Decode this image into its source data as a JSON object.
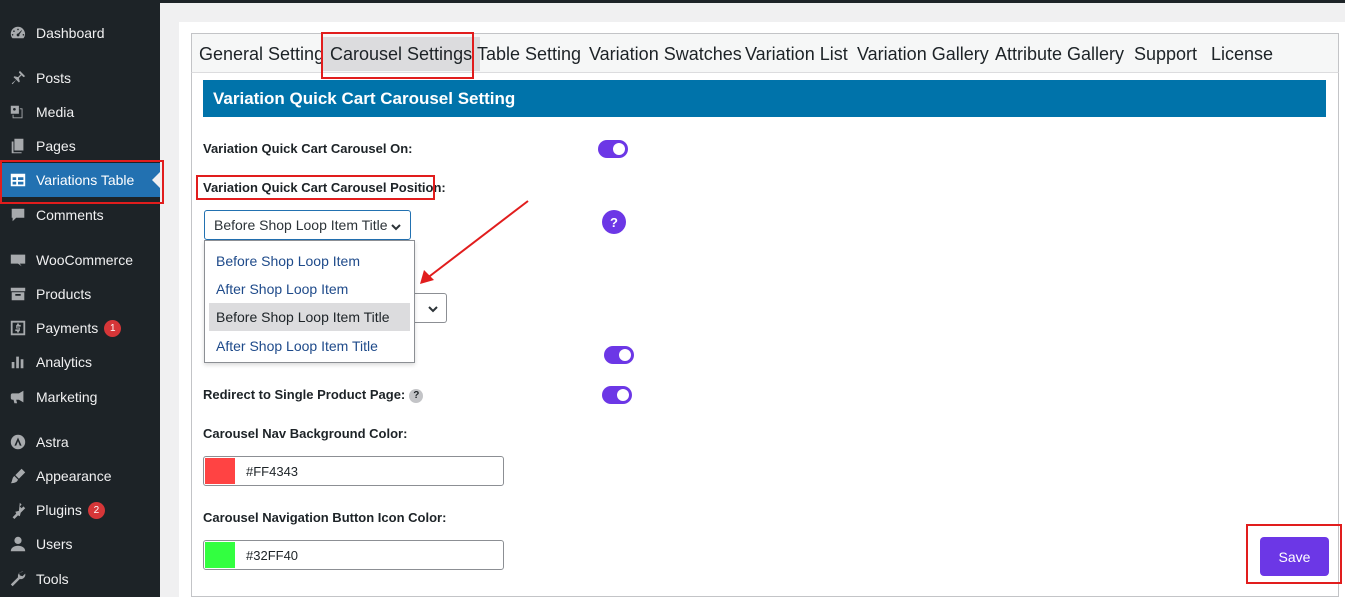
{
  "sidebar": {
    "items": [
      {
        "label": "Dashboard",
        "icon": "dashboard-icon",
        "badge": ""
      },
      {
        "label": "Posts",
        "icon": "pin-icon",
        "badge": ""
      },
      {
        "label": "Media",
        "icon": "media-icon",
        "badge": ""
      },
      {
        "label": "Pages",
        "icon": "pages-icon",
        "badge": ""
      },
      {
        "label": "Variations Table",
        "icon": "table-icon",
        "badge": ""
      },
      {
        "label": "Comments",
        "icon": "comment-icon",
        "badge": ""
      },
      {
        "label": "WooCommerce",
        "icon": "woo-icon",
        "badge": ""
      },
      {
        "label": "Products",
        "icon": "archive-icon",
        "badge": ""
      },
      {
        "label": "Payments",
        "icon": "dollar-icon",
        "badge": "1"
      },
      {
        "label": "Analytics",
        "icon": "chart-icon",
        "badge": ""
      },
      {
        "label": "Marketing",
        "icon": "megaphone-icon",
        "badge": ""
      },
      {
        "label": "Astra",
        "icon": "astra-icon",
        "badge": ""
      },
      {
        "label": "Appearance",
        "icon": "brush-icon",
        "badge": ""
      },
      {
        "label": "Plugins",
        "icon": "plugin-icon",
        "badge": "2"
      },
      {
        "label": "Users",
        "icon": "user-icon",
        "badge": ""
      },
      {
        "label": "Tools",
        "icon": "wrench-icon",
        "badge": ""
      }
    ]
  },
  "tabs": [
    "General Setting",
    "Carousel Settings",
    "Table Setting",
    "Variation Swatches",
    "Variation List",
    "Variation Gallery",
    "Attribute Gallery",
    "Support",
    "License"
  ],
  "section_title": "Variation Quick Cart Carousel Setting",
  "fields": {
    "carousel_on_label": "Variation Quick Cart Carousel On:",
    "position_label": "Variation Quick Cart Carousel Position:",
    "position_value": "Before Shop Loop Item Title",
    "position_options": [
      "Before Shop Loop Item",
      "After Shop Loop Item",
      "Before Shop Loop Item Title",
      "After Shop Loop Item Title"
    ],
    "help_mark": "?",
    "redirect_label": "Redirect to Single Product Page:",
    "nav_bg_label": "Carousel Nav Background Color:",
    "nav_bg_value": "#FF4343",
    "nav_icon_label": "Carousel Navigation Button Icon Color:",
    "nav_icon_value": "#32FF40"
  },
  "save_label": "Save",
  "colors": {
    "accent": "#6c37e6",
    "section": "#0073aa",
    "highlight": "#e11d1d",
    "nav_bg_swatch": "#FF4343",
    "nav_icon_swatch": "#32FF40"
  }
}
